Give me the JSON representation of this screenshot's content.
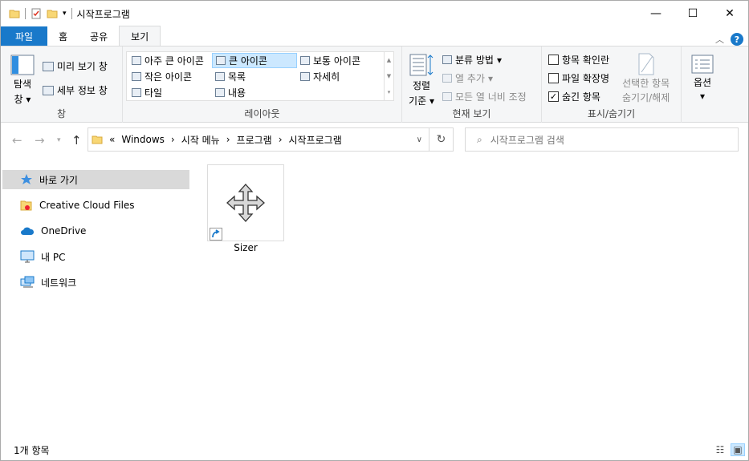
{
  "window": {
    "title": "시작프로그램"
  },
  "titlebar": {
    "minimize": "—",
    "maximize": "☐",
    "close": "✕"
  },
  "tabs": {
    "file": "파일",
    "home": "홈",
    "share": "공유",
    "view": "보기"
  },
  "ribbon": {
    "pane": {
      "nav_pane_line1": "탐색",
      "nav_pane_line2": "창",
      "preview": "미리 보기 창",
      "details": "세부 정보 창",
      "label": "창"
    },
    "layout": {
      "extra_large": "아주 큰 아이콘",
      "large": "큰 아이콘",
      "medium": "보통 아이콘",
      "small": "작은 아이콘",
      "list": "목록",
      "details": "자세히",
      "tiles": "타일",
      "content": "내용",
      "label": "레이아웃"
    },
    "current_view": {
      "sort_line1": "정렬",
      "sort_line2": "기준",
      "group_by": "분류 방법",
      "add_columns": "열 추가",
      "size_columns": "모든 열 너비 조정",
      "label": "현재 보기"
    },
    "show_hide": {
      "item_checkboxes": "항목 확인란",
      "file_extensions": "파일 확장명",
      "hidden_items": "숨긴 항목",
      "hide_selected_line1": "선택한 항목",
      "hide_selected_line2": "숨기기/해제",
      "label": "표시/숨기기",
      "item_checkboxes_checked": false,
      "file_extensions_checked": false,
      "hidden_items_checked": true
    },
    "options": {
      "label": "옵션"
    }
  },
  "address": {
    "overflow": "«",
    "crumbs": [
      "Windows",
      "시작 메뉴",
      "프로그램",
      "시작프로그램"
    ],
    "search_placeholder": "시작프로그램 검색"
  },
  "nav": {
    "items": [
      {
        "label": "바로 가기",
        "icon": "star-icon"
      },
      {
        "label": "Creative Cloud Files",
        "icon": "creative-cloud-folder-icon"
      },
      {
        "label": "OneDrive",
        "icon": "cloud-icon"
      },
      {
        "label": "내 PC",
        "icon": "monitor-icon"
      },
      {
        "label": "네트워크",
        "icon": "network-icon"
      }
    ]
  },
  "files": [
    {
      "name": "Sizer",
      "icon": "move-arrows-icon"
    }
  ],
  "status": {
    "count": "1개 항목"
  },
  "colors": {
    "accent": "#1979ca",
    "selection": "#cce8ff"
  }
}
